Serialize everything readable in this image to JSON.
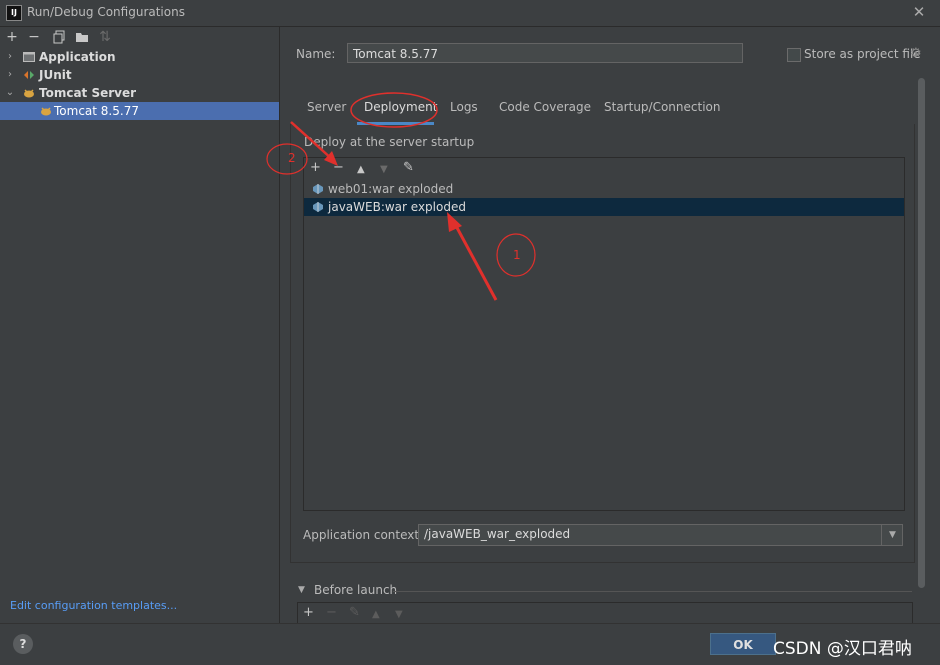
{
  "window": {
    "title": "Run/Debug Configurations",
    "logo_text": "IJ"
  },
  "tree": {
    "items": [
      {
        "label": "Application",
        "bold": true
      },
      {
        "label": "JUnit",
        "bold": true
      },
      {
        "label": "Tomcat Server",
        "bold": true
      },
      {
        "label": "Tomcat 8.5.77",
        "bold": false,
        "selected": true
      }
    ],
    "edit_templates_link": "Edit configuration templates..."
  },
  "config": {
    "name_label": "Name:",
    "name_value": "Tomcat 8.5.77",
    "store_label": "Store as project file",
    "store_checked": false
  },
  "tabs": [
    {
      "label": "Server"
    },
    {
      "label": "Deployment",
      "active": true
    },
    {
      "label": "Logs"
    },
    {
      "label": "Code Coverage"
    },
    {
      "label": "Startup/Connection"
    }
  ],
  "deployment": {
    "section_label": "Deploy at the server startup",
    "items": [
      {
        "label": "web01:war exploded",
        "selected": false
      },
      {
        "label": "javaWEB:war exploded",
        "selected": true
      }
    ],
    "context_label": "Application context:",
    "context_value": "/javaWEB_war_exploded"
  },
  "before_launch": {
    "label": "Before launch"
  },
  "buttons": {
    "ok": "OK",
    "help": "?"
  },
  "annotations": {
    "one": "1",
    "two": "2",
    "color": "#e0302c"
  },
  "watermark": "CSDN @汉口君呐",
  "colors": {
    "accent": "#4a88c7",
    "selection": "#4b6eaf",
    "list_selection": "#0d293e",
    "link": "#589df6"
  }
}
